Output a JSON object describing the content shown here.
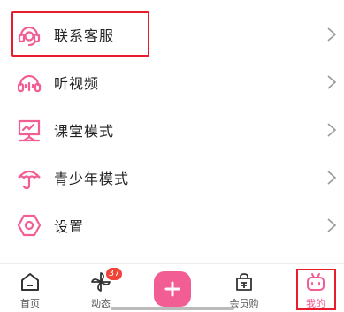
{
  "menu": {
    "items": [
      {
        "label": "联系客服",
        "icon": "headset-icon"
      },
      {
        "label": "听视频",
        "icon": "headphones-icon"
      },
      {
        "label": "课堂模式",
        "icon": "classroom-board-icon"
      },
      {
        "label": "青少年模式",
        "icon": "umbrella-icon"
      },
      {
        "label": "设置",
        "icon": "gear-icon"
      }
    ]
  },
  "tabbar": {
    "home": "首页",
    "dynamic": "动态",
    "dynamic_badge": "37",
    "vip": "会员购",
    "mine": "我的"
  },
  "colors": {
    "accent": "#f25d94",
    "highlight": "#e81c2c"
  }
}
